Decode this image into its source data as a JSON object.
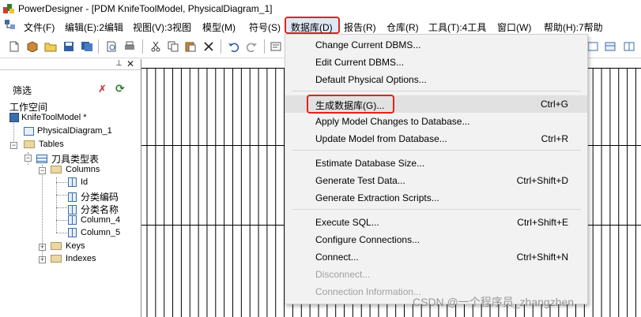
{
  "window": {
    "title": "PowerDesigner - [PDM KnifeToolModel, PhysicalDiagram_1]"
  },
  "menubar": [
    "文件(F)",
    "编辑(E):2编辑",
    "视图(V):3视图",
    "模型(M)",
    "符号(S)",
    "数据库(D)",
    "报告(R)",
    "仓库(R)",
    "工具(T):4工具",
    "窗口(W)",
    "帮助(H):7帮助"
  ],
  "browser": {
    "filter_label": "筛选",
    "filter_value": "",
    "workspace": "工作空间",
    "model": "KnifeToolModel *",
    "diagram": "PhysicalDiagram_1",
    "tables": "Tables",
    "table": "刀具类型表",
    "columns": "Columns",
    "column_items": [
      "Id",
      "分类编码",
      "分类名称",
      "Column_4",
      "Column_5"
    ],
    "keys": "Keys",
    "indexes": "Indexes"
  },
  "db_menu": {
    "items": [
      {
        "label": "Change Current DBMS...",
        "shortcut": "",
        "enabled": true
      },
      {
        "label": "Edit Current DBMS...",
        "shortcut": "",
        "enabled": true
      },
      {
        "label": "Default Physical Options...",
        "shortcut": "",
        "enabled": true
      },
      {
        "label": "生成数据库(G)...",
        "shortcut": "Ctrl+G",
        "enabled": true,
        "highlighted": true
      },
      {
        "label": "Apply Model Changes to Database...",
        "shortcut": "",
        "enabled": true
      },
      {
        "label": "Update Model from Database...",
        "shortcut": "Ctrl+R",
        "enabled": true
      },
      {
        "label": "Estimate Database Size...",
        "shortcut": "",
        "enabled": true
      },
      {
        "label": "Generate Test Data...",
        "shortcut": "Ctrl+Shift+D",
        "enabled": true
      },
      {
        "label": "Generate Extraction Scripts...",
        "shortcut": "",
        "enabled": true
      },
      {
        "label": "Execute SQL...",
        "shortcut": "Ctrl+Shift+E",
        "enabled": true
      },
      {
        "label": "Configure Connections...",
        "shortcut": "",
        "enabled": true
      },
      {
        "label": "Connect...",
        "shortcut": "Ctrl+Shift+N",
        "enabled": true
      },
      {
        "label": "Disconnect...",
        "shortcut": "",
        "enabled": false
      },
      {
        "label": "Connection Information...",
        "shortcut": "",
        "enabled": false
      }
    ]
  },
  "watermark": "CSDN @一个程序员_zhangzhen",
  "colors": {
    "highlight_border": "#e0231b",
    "menu_bg": "#f2f2f2",
    "disabled_text": "#a0a0a0"
  }
}
